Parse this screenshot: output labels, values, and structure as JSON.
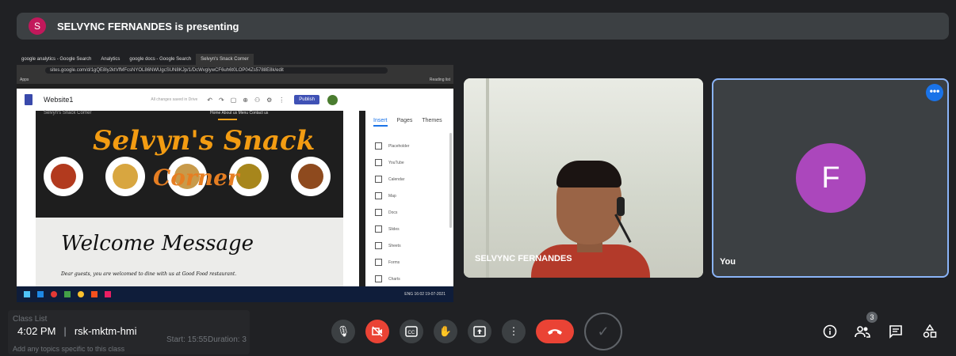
{
  "banner": {
    "avatar_letter": "S",
    "text": "SELVYNC FERNANDES is presenting"
  },
  "browser": {
    "tabs": [
      "google analytics - Google Search",
      "Analytics",
      "google docs - Google Search",
      "Selvyn's Snack Corner"
    ],
    "url": "sites.google.com/d/1gQE8ly2ktVfMFcsNYOL86NWUgcSUN8KJp/1/DcWvgIywCF6uh6t0LOP04Zs5788E8k/edit",
    "bookmarks_left": "Apps",
    "bookmarks_right": "Reading list"
  },
  "sites": {
    "title": "Website1",
    "saved": "All changes saved in Drive",
    "publish": "Publish",
    "panel_tabs": [
      "Insert",
      "Pages",
      "Themes"
    ],
    "panel_items": [
      "Placeholder",
      "YouTube",
      "Calendar",
      "Map",
      "Docs",
      "Slides",
      "Sheets",
      "Forms",
      "Charts"
    ]
  },
  "site_content": {
    "nav_left": "Selvyn's Snack Corner",
    "nav_right": "Home   About us   Menu   Contact us",
    "title_1": "Selvyn's Snack",
    "title_2": "Corner",
    "welcome": "Welcome Message",
    "welcome_sub": "Dear guests, you are welcomed to dine with us at Good Food restaurant."
  },
  "taskbar": {
    "tray": "ENG",
    "time": "16:02",
    "date": "19-07-2021"
  },
  "tiles": {
    "presenter_name": "SELVYNC FERNANDES",
    "self_letter": "F",
    "self_label": "You"
  },
  "meeting": {
    "time": "4:02 PM",
    "code": "rsk-mktm-hmi",
    "people_count": "3"
  },
  "ghost": {
    "class_list": "Class List",
    "start": "Start: 15:55",
    "duration": "Duration: 3",
    "topic": "Add any topics specific to this class"
  },
  "colors": {
    "accent": "#1a73e8",
    "danger": "#ea4335",
    "self_avatar": "#ab47bc",
    "presenter_avatar": "#c2185b"
  }
}
